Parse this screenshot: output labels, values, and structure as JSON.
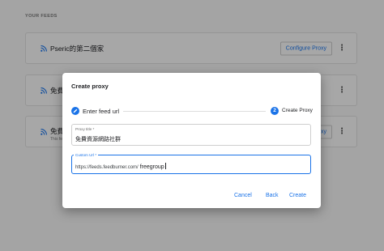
{
  "section_label": "YOUR FEEDS",
  "feeds": [
    {
      "title": "Pseric的第二個家",
      "subtitle": "",
      "button": "Configure Proxy"
    },
    {
      "title": "免費",
      "subtitle": "",
      "button": ""
    },
    {
      "title": "免費",
      "subtitle": "This fe",
      "button": "oxy"
    }
  ],
  "dialog": {
    "title": "Create proxy",
    "steps": [
      {
        "number": "",
        "label": "Enter feed url",
        "icon": "pencil-icon"
      },
      {
        "number": "2",
        "label": "Create Proxy"
      }
    ],
    "proxy_title": {
      "label": "Proxy title *",
      "value": "免費資源網路社群"
    },
    "custom_url": {
      "label": "Custom Url *",
      "prefix": "https://feeds.feedburner.com/",
      "value": "freegroup"
    },
    "buttons": {
      "cancel": "Cancel",
      "back": "Back",
      "create": "Create"
    }
  },
  "colors": {
    "accent": "#1a73e8",
    "overlay": "rgba(0,0,0,0.32)",
    "background": "#f2f2f2"
  }
}
